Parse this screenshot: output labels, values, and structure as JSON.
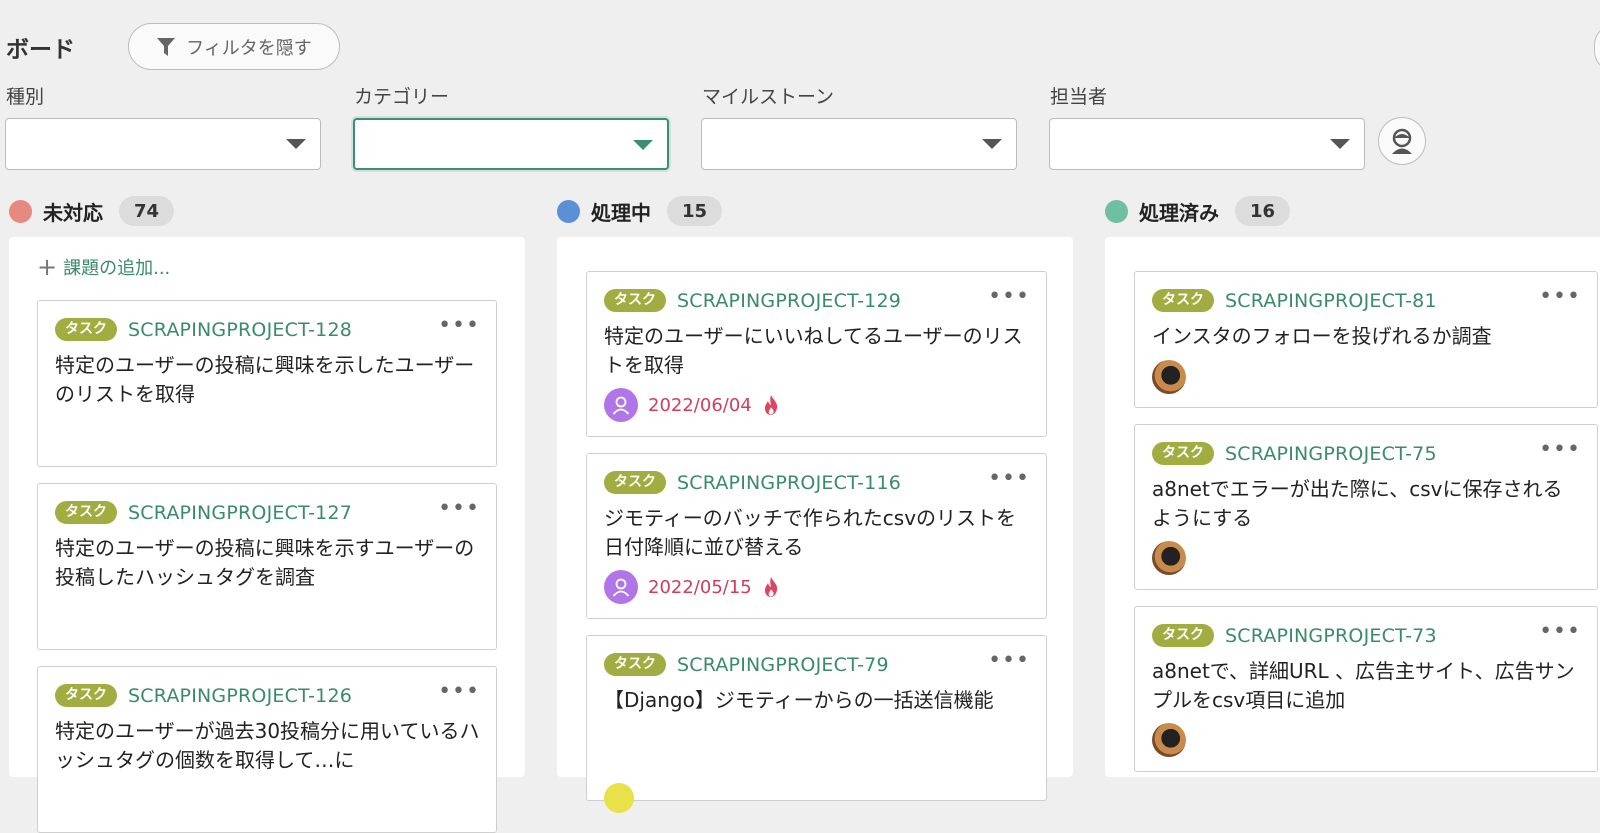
{
  "header": {
    "title": "ボード",
    "filter_button": "フィルタを隠す"
  },
  "filters": [
    {
      "label": "種別",
      "value": ""
    },
    {
      "label": "カテゴリー",
      "value": ""
    },
    {
      "label": "マイルストーン",
      "value": ""
    },
    {
      "label": "担当者",
      "value": ""
    }
  ],
  "columns": [
    {
      "name": "未対応",
      "count": "74",
      "color": "#e68a80",
      "add_label": "課題の追加...",
      "cards": [
        {
          "tag": "タスク",
          "key": "SCRAPINGPROJECT-128",
          "title": "特定のユーザーの投稿に興味を示したユーザーのリストを取得"
        },
        {
          "tag": "タスク",
          "key": "SCRAPINGPROJECT-127",
          "title": "特定のユーザーの投稿に興味を示すユーザーの投稿したハッシュタグを調査"
        },
        {
          "tag": "タスク",
          "key": "SCRAPINGPROJECT-126",
          "title": "特定のユーザーが過去30投稿分に用いているハッシュタグの個数を取得して…に"
        }
      ]
    },
    {
      "name": "処理中",
      "count": "15",
      "color": "#5b8fd6",
      "cards": [
        {
          "tag": "タスク",
          "key": "SCRAPINGPROJECT-129",
          "title": "特定のユーザーにいいねしてるユーザーのリストを取得",
          "due": "2022/06/04"
        },
        {
          "tag": "タスク",
          "key": "SCRAPINGPROJECT-116",
          "title": "ジモティーのバッチで作られたcsvのリストを日付降順に並び替える",
          "due": "2022/05/15"
        },
        {
          "tag": "タスク",
          "key": "SCRAPINGPROJECT-79",
          "title": "【Django】ジモティーからの一括送信機能"
        }
      ]
    },
    {
      "name": "処理済み",
      "count": "16",
      "color": "#6fbfa3",
      "cards": [
        {
          "tag": "タスク",
          "key": "SCRAPINGPROJECT-81",
          "title": "インスタのフォローを投げれるか調査"
        },
        {
          "tag": "タスク",
          "key": "SCRAPINGPROJECT-75",
          "title": "a8netでエラーが出た際に、csvに保存されるようにする"
        },
        {
          "tag": "タスク",
          "key": "SCRAPINGPROJECT-73",
          "title": "a8netで、詳細URL 、広告主サイト、広告サンプルをcsv項目に追加"
        }
      ]
    }
  ]
}
